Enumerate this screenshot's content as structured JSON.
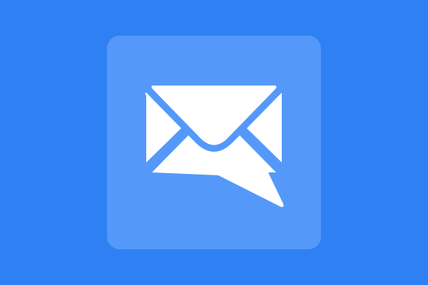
{
  "colors": {
    "background": "#2f80f2",
    "tile": "#5499f9",
    "glyph": "#ffffff"
  },
  "icon": {
    "name": "mail-chat-icon"
  }
}
